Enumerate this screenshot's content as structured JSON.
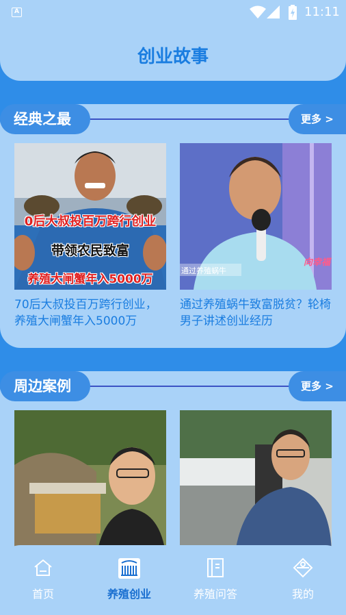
{
  "status_bar": {
    "time": "11:11"
  },
  "header": {
    "title": "创业故事"
  },
  "sections": [
    {
      "title": "经典之最",
      "more_label": "更多 >",
      "items": [
        {
          "caption": "70后大叔投百万跨行创业，养殖大闸蟹年入5000万",
          "overlay_lines": [
            "0后大叔投百万跨行创业",
            "带领农民致富",
            "养殖大闸蟹年入5000万"
          ]
        },
        {
          "caption": "通过养殖蜗牛致富脱贫？轮椅男子讲述创业经历",
          "overlay_lines": [
            "通过养殖蜗牛",
            "向幸福"
          ]
        }
      ]
    },
    {
      "title": "周边案例",
      "more_label": "更多 >",
      "items": [
        {
          "caption": ""
        },
        {
          "caption": ""
        }
      ]
    }
  ],
  "nav": [
    {
      "label": "首页",
      "icon": "home-icon"
    },
    {
      "label": "养殖创业",
      "icon": "farm-icon"
    },
    {
      "label": "养殖问答",
      "icon": "book-icon"
    },
    {
      "label": "我的",
      "icon": "profile-icon"
    }
  ],
  "colors": {
    "accent": "#1a7de0",
    "background": "#2f8de8",
    "card": "#a9d2f8"
  }
}
